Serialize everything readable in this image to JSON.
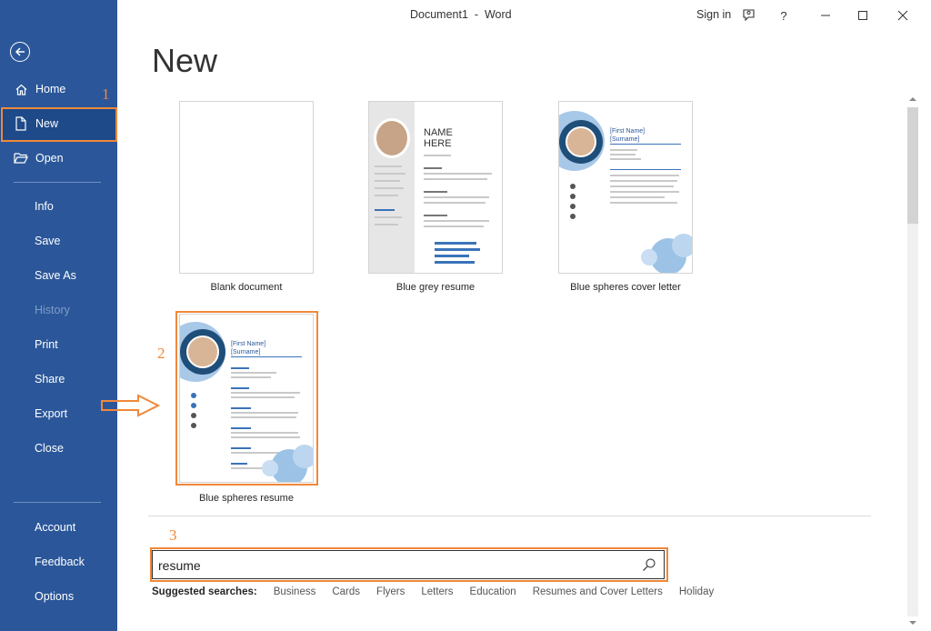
{
  "window": {
    "doc_title": "Document1  -  Word",
    "sign_in": "Sign in",
    "help_glyph": "?",
    "minimize_icon": "minimize-icon",
    "maximize_icon": "maximize-icon",
    "close_icon": "close-icon"
  },
  "sidebar": {
    "items": [
      {
        "label": "Home",
        "icon": "home-icon"
      },
      {
        "label": "New",
        "icon": "new-document-icon",
        "active": true
      },
      {
        "label": "Open",
        "icon": "open-folder-icon"
      },
      {
        "label": "Info"
      },
      {
        "label": "Save"
      },
      {
        "label": "Save As"
      },
      {
        "label": "History",
        "disabled": true
      },
      {
        "label": "Print"
      },
      {
        "label": "Share"
      },
      {
        "label": "Export"
      },
      {
        "label": "Close"
      },
      {
        "label": "Account"
      },
      {
        "label": "Feedback"
      },
      {
        "label": "Options"
      }
    ]
  },
  "main": {
    "title": "New",
    "templates": [
      {
        "caption": "Blank document"
      },
      {
        "caption": "Blue grey resume"
      },
      {
        "caption": "Blue spheres cover letter"
      },
      {
        "caption": "Blue spheres resume"
      }
    ],
    "blue_grey_resume": {
      "name_line1": "NAME",
      "name_line2": "HERE"
    },
    "blue_spheres": {
      "first_name": "[First Name]",
      "surname": "[Surname]"
    },
    "search": {
      "value": "resume"
    },
    "suggested": {
      "lead": "Suggested searches:",
      "items": [
        "Business",
        "Cards",
        "Flyers",
        "Letters",
        "Education",
        "Resumes and Cover Letters",
        "Holiday"
      ]
    }
  },
  "annotations": {
    "one": "1",
    "two": "2",
    "three": "3"
  },
  "colors": {
    "sidebar": "#2b579a",
    "accent": "#f0883a",
    "resume_blue": "#3b73b9"
  }
}
